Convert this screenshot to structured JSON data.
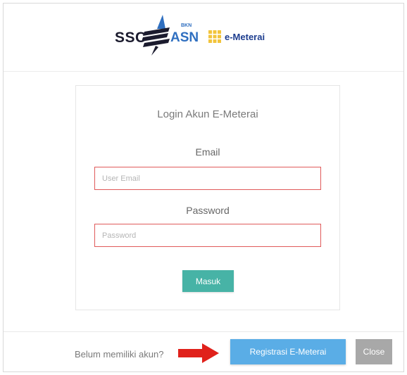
{
  "header": {
    "logo_ssc": "SSC",
    "logo_asn": "ASN",
    "logo_asn_small": "BKN",
    "logo_emeterai": "e-Meterai"
  },
  "login": {
    "title": "Login Akun E-Meterai",
    "email_label": "Email",
    "email_placeholder": "User Email",
    "password_label": "Password",
    "password_placeholder": "Password",
    "submit_label": "Masuk"
  },
  "footer": {
    "no_account_text": "Belum memiliki akun?",
    "register_label": "Registrasi E-Meterai",
    "close_label": "Close"
  },
  "colors": {
    "input_border_invalid": "#e05a5a",
    "submit_bg": "#47b3a6",
    "register_bg": "#5aade6",
    "close_bg": "#a8a8a8",
    "arrow": "#e0211b"
  },
  "icons": [
    "ssc-asn-logo-mark",
    "emeterai-logo-mark",
    "red-arrow-icon"
  ]
}
